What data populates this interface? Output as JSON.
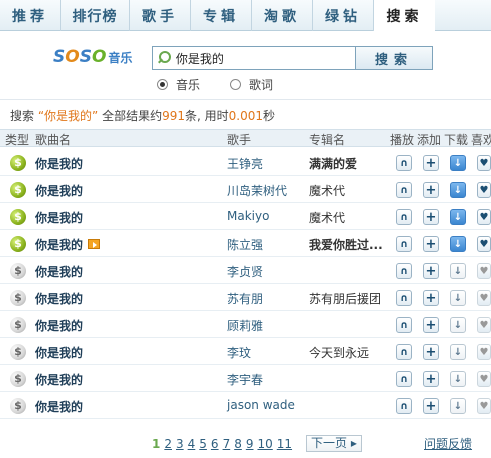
{
  "tabs": [
    "推荐",
    "排行榜",
    "歌手",
    "专辑",
    "淘歌",
    "绿钻",
    "搜索"
  ],
  "logo": {
    "text": "SOSO",
    "suffix": "音乐"
  },
  "search": {
    "value": "你是我的",
    "button": "搜索"
  },
  "radios": [
    {
      "label": "音乐",
      "checked": true
    },
    {
      "label": "歌词",
      "checked": false
    }
  ],
  "summary": {
    "prefix": "搜索 ",
    "query": "“你是我的”",
    "middle": " 全部结果约",
    "count": "991",
    "middle2": "条, 用时",
    "time": "0.001",
    "suffix": "秒"
  },
  "columns": [
    "类型",
    "歌曲名",
    "歌手",
    "专辑名",
    "播放",
    "添加",
    "下载",
    "喜欢"
  ],
  "rows": [
    {
      "type": "gold",
      "song": "你是我的",
      "mv": false,
      "singer": "王铮亮",
      "album": "满满的爱",
      "album_bold": true,
      "download": "active",
      "like": "active"
    },
    {
      "type": "gold",
      "song": "你是我的",
      "mv": false,
      "singer": "川岛茉树代",
      "album": "魔术代",
      "album_bold": false,
      "download": "active",
      "like": "active"
    },
    {
      "type": "gold",
      "song": "你是我的",
      "mv": false,
      "singer": "Makiyo",
      "album": "魔术代",
      "album_bold": false,
      "download": "active",
      "like": "active"
    },
    {
      "type": "gold",
      "song": "你是我的",
      "mv": true,
      "singer": "陈立强",
      "album": "我爱你胜过...",
      "album_bold": true,
      "download": "active",
      "like": "active"
    },
    {
      "type": "grey",
      "song": "你是我的",
      "mv": false,
      "singer": "李贞贤",
      "album": "",
      "album_bold": false,
      "download": "inactive",
      "like": "inactive"
    },
    {
      "type": "grey",
      "song": "你是我的",
      "mv": false,
      "singer": "苏有朋",
      "album": "苏有朋后援团",
      "album_bold": false,
      "download": "inactive",
      "like": "inactive"
    },
    {
      "type": "grey",
      "song": "你是我的",
      "mv": false,
      "singer": "顾莉雅",
      "album": "",
      "album_bold": false,
      "download": "inactive",
      "like": "inactive"
    },
    {
      "type": "grey",
      "song": "你是我的",
      "mv": false,
      "singer": "李玟",
      "album": "今天到永远",
      "album_bold": false,
      "download": "inactive",
      "like": "inactive"
    },
    {
      "type": "grey",
      "song": "你是我的",
      "mv": false,
      "singer": "李宇春",
      "album": "",
      "album_bold": false,
      "download": "inactive",
      "like": "inactive"
    },
    {
      "type": "grey",
      "song": "你是我的",
      "mv": false,
      "singer": "jason wade",
      "album": "",
      "album_bold": false,
      "download": "inactive",
      "like": "inactive"
    }
  ],
  "pager": {
    "pages": [
      "1",
      "2",
      "3",
      "4",
      "5",
      "6",
      "7",
      "8",
      "9",
      "10",
      "11"
    ],
    "current": "1",
    "next": "下一页 ▸"
  },
  "feedback": "问题反馈",
  "icons": {
    "play": "headphone-icon",
    "add": "plus-icon",
    "download": "download-icon",
    "like": "heart-icon"
  }
}
